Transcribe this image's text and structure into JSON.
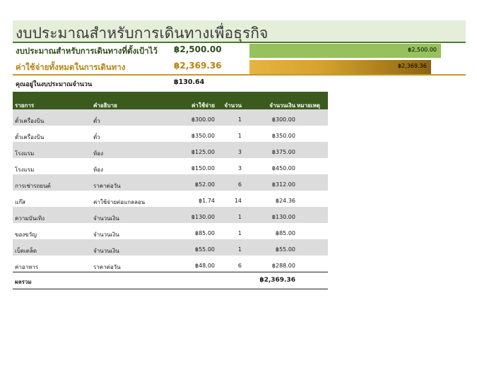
{
  "title": "งบประมาณสำหรับการเดินทางเพื่อธุรกิจ",
  "summary": {
    "budget_label": "งบประมาณสำหรับการเดินทางที่ตั้งเป้าไว้",
    "budget_value": "฿2,500.00",
    "budget_bar_label": "฿2,500.00",
    "budget_fraction": 1.0,
    "total_label": "ค่าใช้จ่ายทั้งหมดในการเดินทาง",
    "total_value": "฿2,369.36",
    "total_bar_label": "฿2,369.36",
    "total_fraction": 0.9477,
    "remaining_label": "คุณอยู่ในงบประมาณจำนวน",
    "remaining_value": "฿130.64"
  },
  "colors": {
    "budget_text": "#2f4d1a",
    "total_text": "#b5820f",
    "header_bg": "#3a5a1e"
  },
  "table": {
    "headers": {
      "item": "รายการ",
      "desc": "คำอธิบาย",
      "cost": "ค่าใช้จ่าย",
      "qty": "จำนวน",
      "amount": "จำนวนเงิน",
      "note": "หมายเหตุ"
    },
    "rows": [
      {
        "item": "ตั๋วเครื่องบิน",
        "desc": "ตั๋ว",
        "cost": "฿300.00",
        "qty": "1",
        "amount": "฿300.00",
        "note": ""
      },
      {
        "item": "ตั๋วเครื่องบิน",
        "desc": "ตั๋ว",
        "cost": "฿350.00",
        "qty": "1",
        "amount": "฿350.00",
        "note": ""
      },
      {
        "item": "โรงแรม",
        "desc": "ห้อง",
        "cost": "฿125.00",
        "qty": "3",
        "amount": "฿375.00",
        "note": ""
      },
      {
        "item": "โรงแรม",
        "desc": "ห้อง",
        "cost": "฿150.00",
        "qty": "3",
        "amount": "฿450.00",
        "note": ""
      },
      {
        "item": "การเช่ารถยนต์",
        "desc": "ราคาต่อวัน",
        "cost": "฿52.00",
        "qty": "6",
        "amount": "฿312.00",
        "note": ""
      },
      {
        "item": "แก๊ส",
        "desc": "ค่าใช้จ่ายต่อแกลลอน",
        "cost": "฿1.74",
        "qty": "14",
        "amount": "฿24.36",
        "note": ""
      },
      {
        "item": "ความบันเทิง",
        "desc": "จำนวนเงิน",
        "cost": "฿130.00",
        "qty": "1",
        "amount": "฿130.00",
        "note": ""
      },
      {
        "item": "ของขวัญ",
        "desc": "จำนวนเงิน",
        "cost": "฿85.00",
        "qty": "1",
        "amount": "฿85.00",
        "note": ""
      },
      {
        "item": "เบ็ดเตล็ด",
        "desc": "จำนวนเงิน",
        "cost": "฿55.00",
        "qty": "1",
        "amount": "฿55.00",
        "note": ""
      },
      {
        "item": "ค่าอาหาร",
        "desc": "ราคาต่อวัน",
        "cost": "฿48.00",
        "qty": "6",
        "amount": "฿288.00",
        "note": ""
      }
    ],
    "total_label": "ผลรวม",
    "total_amount": "฿2,369.36"
  }
}
